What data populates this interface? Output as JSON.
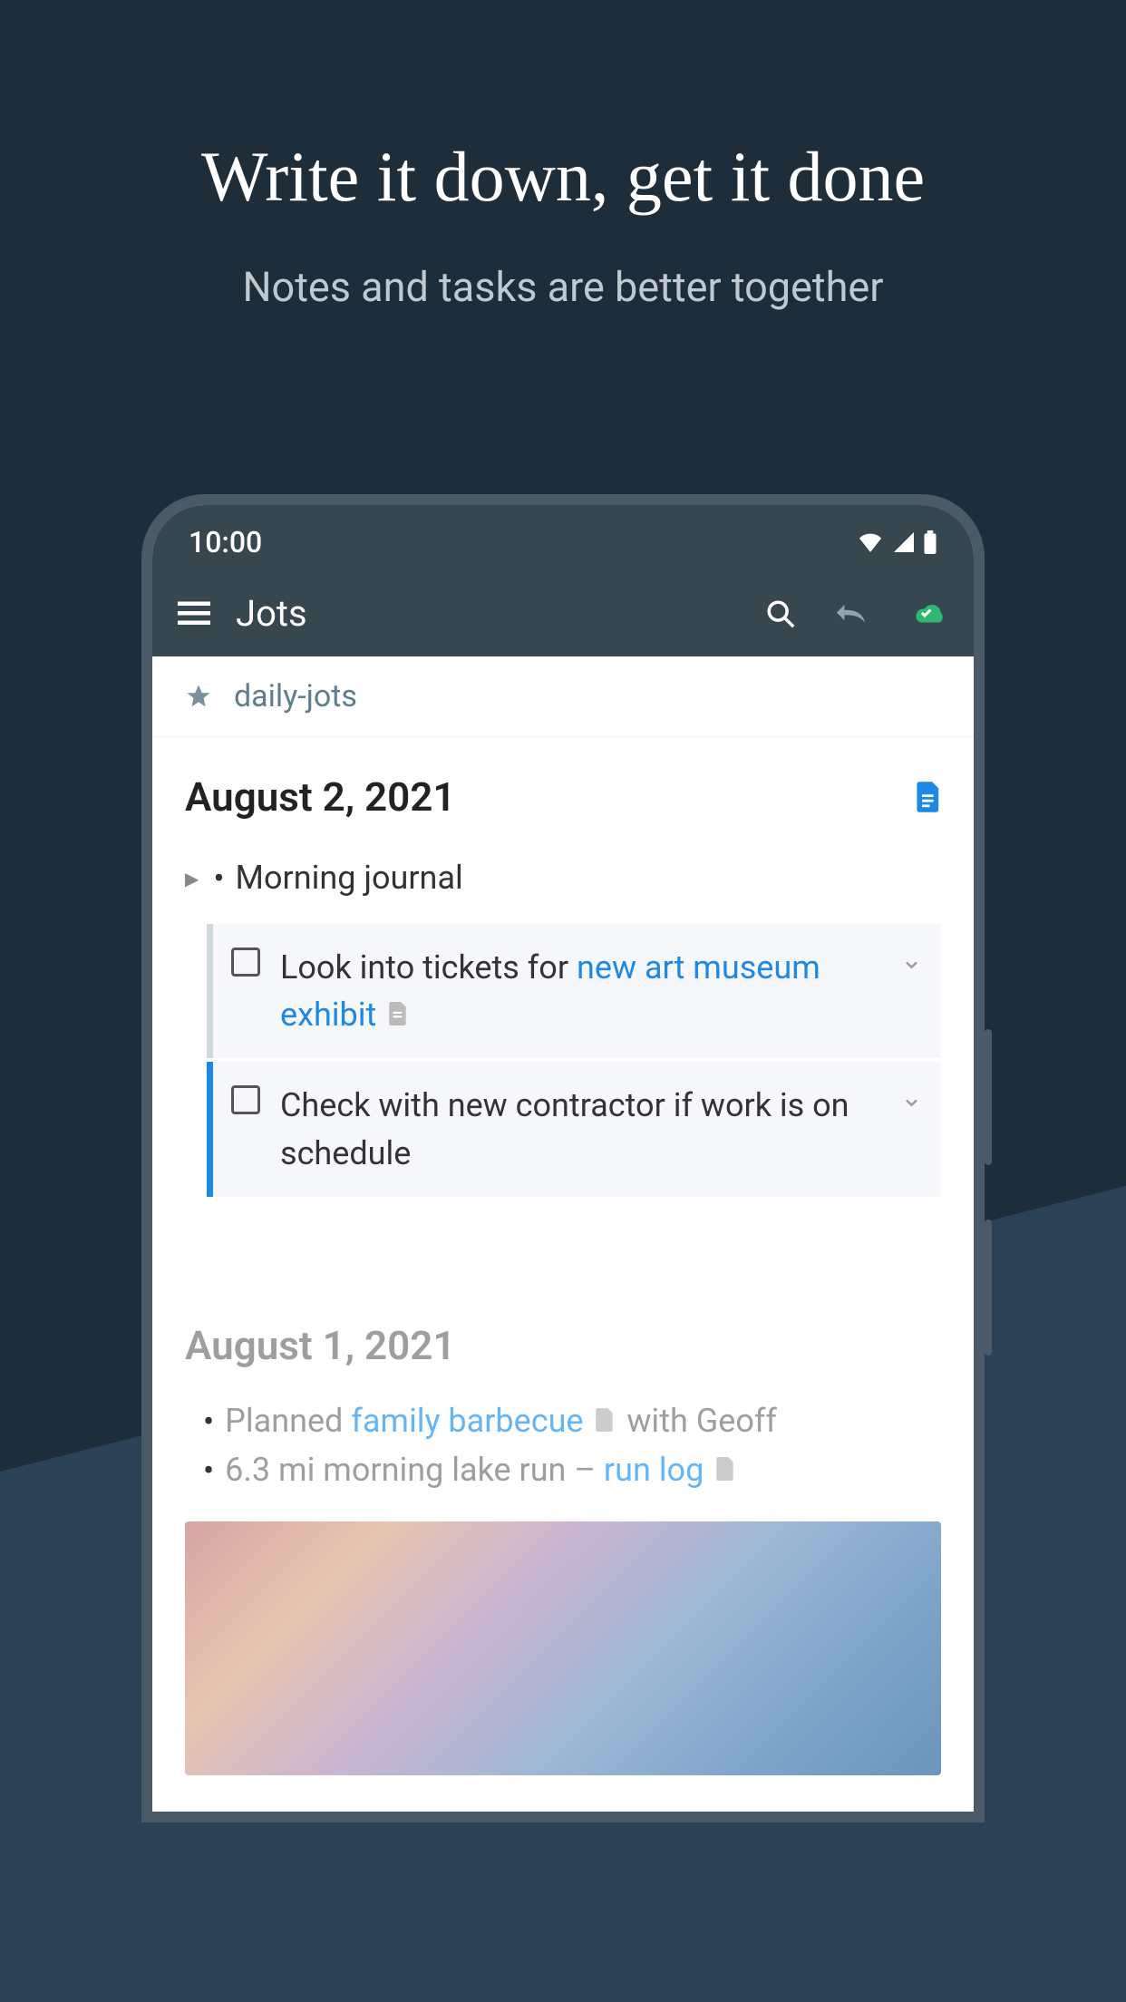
{
  "promo": {
    "headline": "Write it down, get it done",
    "subhead": "Notes and tasks are better together"
  },
  "statusbar": {
    "time": "10:00"
  },
  "appbar": {
    "title": "Jots"
  },
  "breadcrumb": {
    "label": "daily-jots"
  },
  "sections": [
    {
      "date": "August 2, 2021",
      "journal_label": "Morning journal",
      "tasks": [
        {
          "pre": "Look into tickets for ",
          "link": "new art museum exhibit",
          "post": ""
        },
        {
          "pre": "Check with new contractor if work is on schedule",
          "link": "",
          "post": ""
        }
      ]
    },
    {
      "date": "August 1, 2021",
      "items": [
        {
          "pre": "Planned ",
          "link": "family barbecue",
          "post": "  with Geoff"
        },
        {
          "pre": "6.3 mi morning lake run – ",
          "link": "run log",
          "post": ""
        }
      ]
    }
  ]
}
